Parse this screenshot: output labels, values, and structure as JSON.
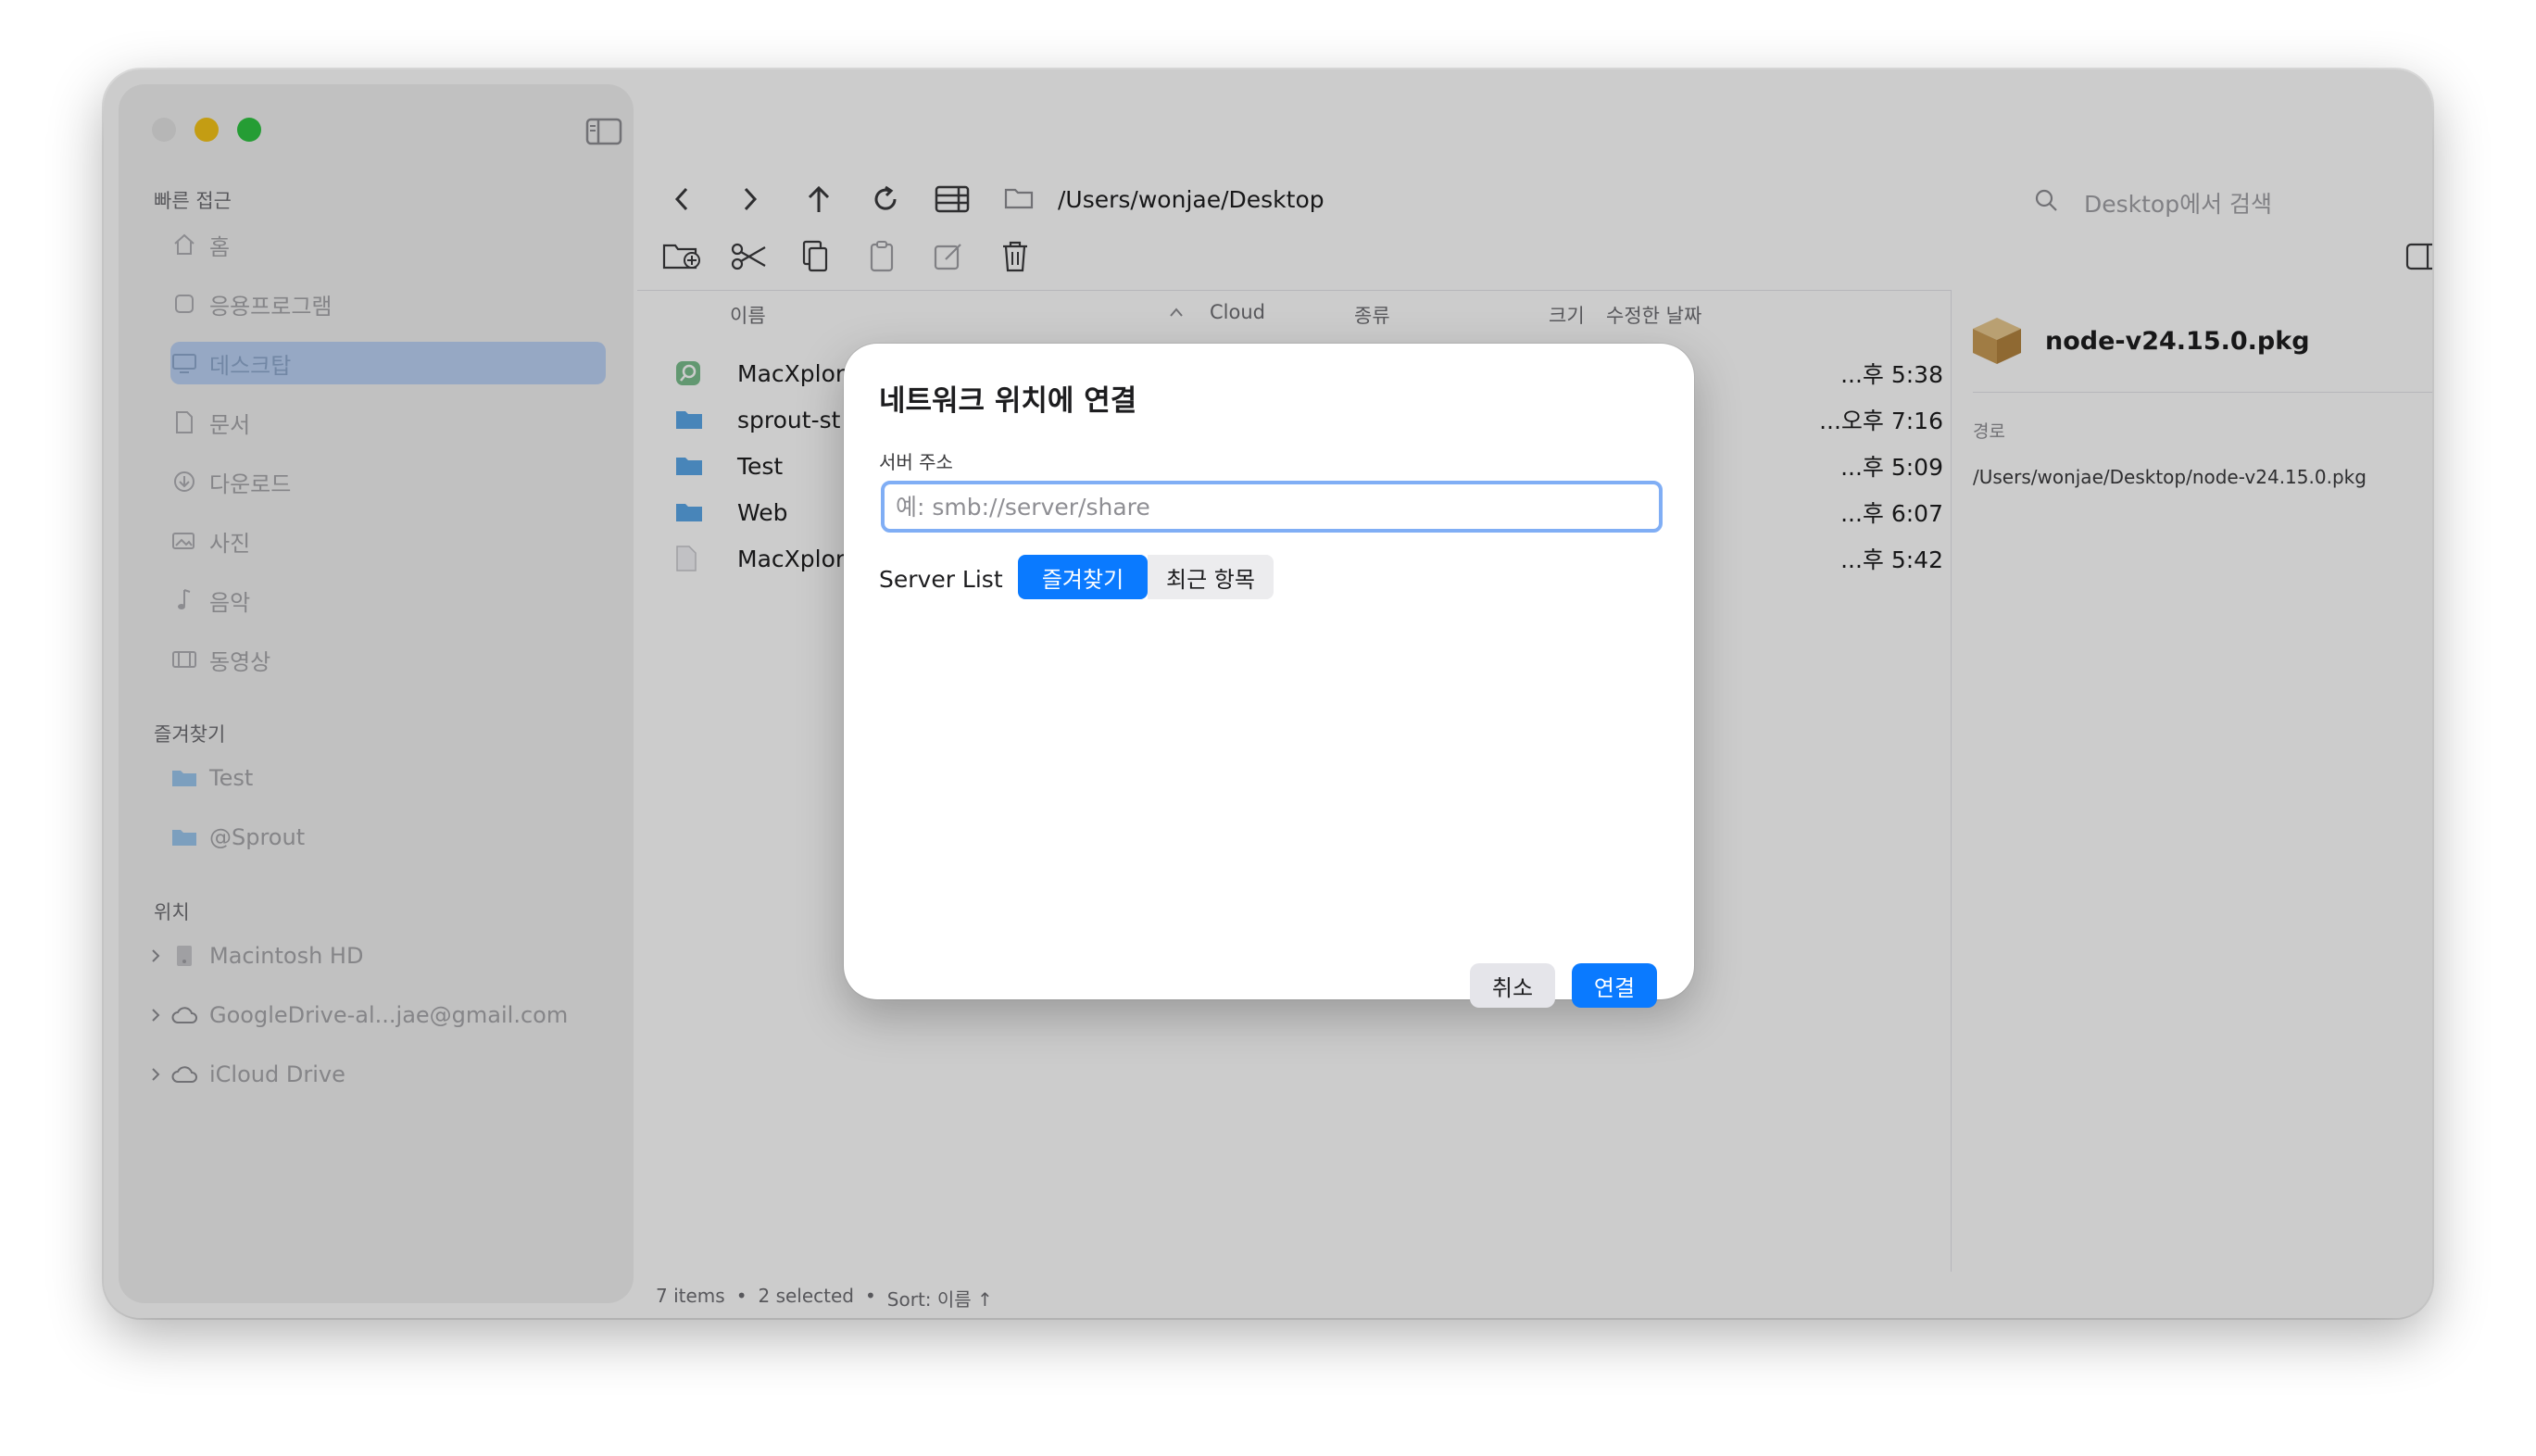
{
  "sidebar": {
    "sections": {
      "quick_access": "빠른 접근",
      "favorites": "즐겨찾기",
      "locations": "위치"
    },
    "quick_items": [
      {
        "label": "홈",
        "icon": "house-icon"
      },
      {
        "label": "응용프로그램",
        "icon": "applications-icon"
      },
      {
        "label": "데스크탑",
        "icon": "desktop-icon"
      },
      {
        "label": "문서",
        "icon": "document-icon"
      },
      {
        "label": "다운로드",
        "icon": "download-icon"
      },
      {
        "label": "사진",
        "icon": "photo-icon"
      },
      {
        "label": "음악",
        "icon": "music-icon"
      },
      {
        "label": "동영상",
        "icon": "film-icon"
      }
    ],
    "favorite_items": [
      {
        "label": "Test",
        "icon": "folder-icon"
      },
      {
        "label": "@Sprout",
        "icon": "folder-icon"
      }
    ],
    "location_items": [
      {
        "label": "Macintosh HD",
        "icon": "disk-icon"
      },
      {
        "label": "GoogleDrive-al...jae@gmail.com",
        "icon": "cloud-icon"
      },
      {
        "label": "iCloud Drive",
        "icon": "cloud-icon"
      }
    ]
  },
  "toolbar": {
    "path": "/Users/wonjae/Desktop",
    "search_placeholder": "Desktop에서 검색"
  },
  "columns": {
    "name": "이름",
    "cloud": "Cloud",
    "kind": "종류",
    "size": "크기",
    "modified": "수정한 날짜"
  },
  "files": [
    {
      "name": "MacXplor",
      "date": "...후 5:38",
      "icon": "app-icon"
    },
    {
      "name": "sprout-st",
      "date": "...오후 7:16",
      "icon": "folder-icon"
    },
    {
      "name": "Test",
      "date": "...후 5:09",
      "icon": "folder-icon"
    },
    {
      "name": "Web",
      "date": "...후 6:07",
      "icon": "folder-icon"
    },
    {
      "name": "MacXplor",
      "date": "...후 5:42",
      "icon": "file-icon"
    }
  ],
  "preview": {
    "filename": "node-v24.15.0.pkg",
    "path_label": "경로",
    "path_value": "/Users/wonjae/Desktop/node-v24.15.0.pkg"
  },
  "status_bar": {
    "items": "7 items",
    "selected": "2 selected",
    "sort": "Sort: 이름 ↑",
    "separator": "•"
  },
  "dialog": {
    "title": "네트워크 위치에 연결",
    "server_label": "서버 주소",
    "server_placeholder": "예: smb://server/share",
    "server_list_label": "Server List",
    "tab_favorites": "즐겨찾기",
    "tab_recent": "최근 항목",
    "cancel": "취소",
    "connect": "연결"
  },
  "colors": {
    "accent": "#0a7aff",
    "folder": "#5ba7e8",
    "close": "#d9d9d9",
    "minimize": "#f5c518",
    "zoom": "#2fc541"
  }
}
